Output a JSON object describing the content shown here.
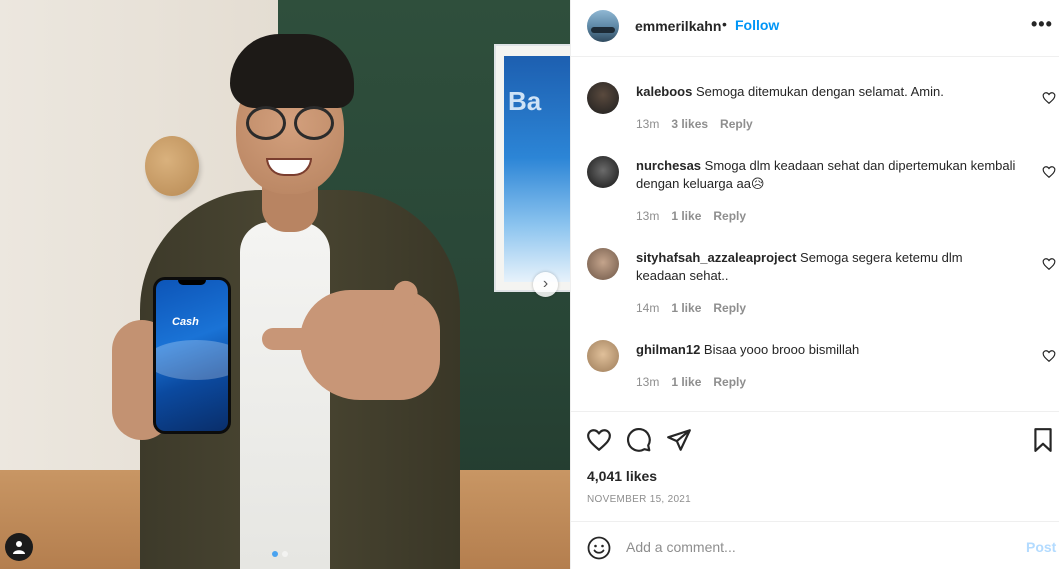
{
  "post": {
    "username": "emmerilkahn",
    "separator": "•",
    "follow_label": "Follow",
    "more_label": "•••"
  },
  "photo": {
    "phone_logo": "Cash",
    "poster_text": "Ba",
    "carousel_next": "›",
    "carousel_count": 2,
    "carousel_active": 1
  },
  "comments": [
    {
      "user": "kaleboos",
      "text": "Semoga ditemukan dengan selamat. Amin.",
      "time": "13m",
      "likes": "3 likes",
      "reply": "Reply",
      "avatar_color": "#3a3a3a"
    },
    {
      "user": "nurchesas",
      "text": "Smoga dlm keadaan sehat dan dipertemukan kembali dengan keluarga aa😥",
      "time": "13m",
      "likes": "1 like",
      "reply": "Reply",
      "avatar_color": "#2a2a2a"
    },
    {
      "user": "sityhafsah_azzaleaproject",
      "text": "Semoga segera ketemu dlm keadaan sehat..",
      "time": "14m",
      "likes": "1 like",
      "reply": "Reply",
      "avatar_color": "#8a6d5a"
    },
    {
      "user": "ghilman12",
      "text": "Bisaa yooo brooo bismillah",
      "time": "13m",
      "likes": "1 like",
      "reply": "Reply",
      "avatar_color": "#c9a57a"
    }
  ],
  "actions": {
    "likes": "4,041 likes",
    "date": "NOVEMBER 15, 2021"
  },
  "composer": {
    "placeholder": "Add a comment...",
    "post_label": "Post"
  },
  "colors": {
    "link_blue": "#0095f6",
    "post_disabled": "#b3dbff",
    "meta_gray": "#8e8e8e",
    "border": "#efefef"
  }
}
